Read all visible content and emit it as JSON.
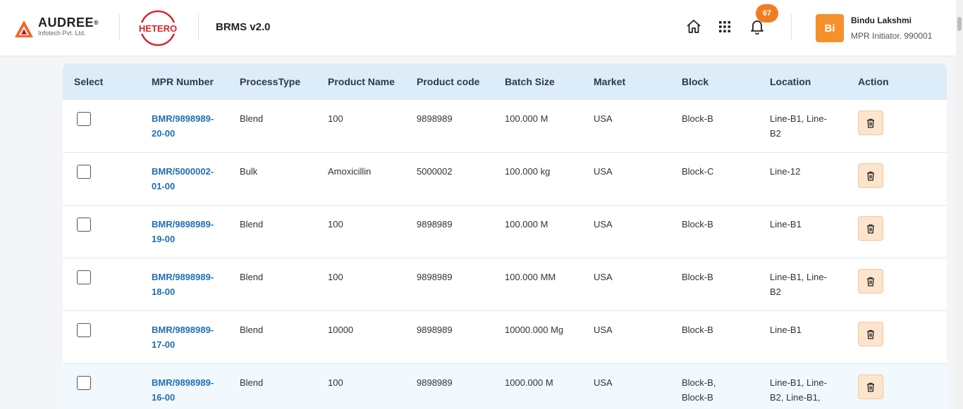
{
  "brand": {
    "name": "AUDREE",
    "reg": "®",
    "sub": "Infotech Pvt. Ltd."
  },
  "partner": {
    "logo_text": "HETERO"
  },
  "app": {
    "title": "BRMS v2.0"
  },
  "notifications": {
    "count": "67"
  },
  "user": {
    "initials": "Bi",
    "name": "Bindu Lakshmi",
    "role": "MPR Initiator. 990001"
  },
  "colors": {
    "accent": "#f07e20",
    "header_bg": "#dcecf8",
    "link": "#1f6fb5",
    "delete_bg": "#fde4cc"
  },
  "table": {
    "headers": {
      "select": "Select",
      "mpr": "MPR Number",
      "process": "ProcessType",
      "product": "Product Name",
      "code": "Product code",
      "batch": "Batch Size",
      "market": "Market",
      "block": "Block",
      "location": "Location",
      "action": "Action"
    },
    "rows": [
      {
        "mpr": "BMR/9898989-20-00",
        "process": "Blend",
        "product": "100",
        "code": "9898989",
        "batch": "100.000 M",
        "market": "USA",
        "block": "Block-B",
        "location": "Line-B1, Line-B2"
      },
      {
        "mpr": "BMR/5000002-01-00",
        "process": "Bulk",
        "product": "Amoxicillin",
        "code": "5000002",
        "batch": "100.000 kg",
        "market": "USA",
        "block": "Block-C",
        "location": "Line-12"
      },
      {
        "mpr": "BMR/9898989-19-00",
        "process": "Blend",
        "product": "100",
        "code": "9898989",
        "batch": "100.000 M",
        "market": "USA",
        "block": "Block-B",
        "location": "Line-B1"
      },
      {
        "mpr": "BMR/9898989-18-00",
        "process": "Blend",
        "product": "100",
        "code": "9898989",
        "batch": "100.000 MM",
        "market": "USA",
        "block": "Block-B",
        "location": "Line-B1, Line-B2"
      },
      {
        "mpr": "BMR/9898989-17-00",
        "process": "Blend",
        "product": "10000",
        "code": "9898989",
        "batch": "10000.000 Mg",
        "market": "USA",
        "block": "Block-B",
        "location": "Line-B1"
      },
      {
        "mpr": "BMR/9898989-16-00",
        "process": "Blend",
        "product": "100",
        "code": "9898989",
        "batch": "1000.000 M",
        "market": "USA",
        "block": "Block-B, Block-B",
        "location": "Line-B1, Line-B2, Line-B1,"
      }
    ]
  }
}
